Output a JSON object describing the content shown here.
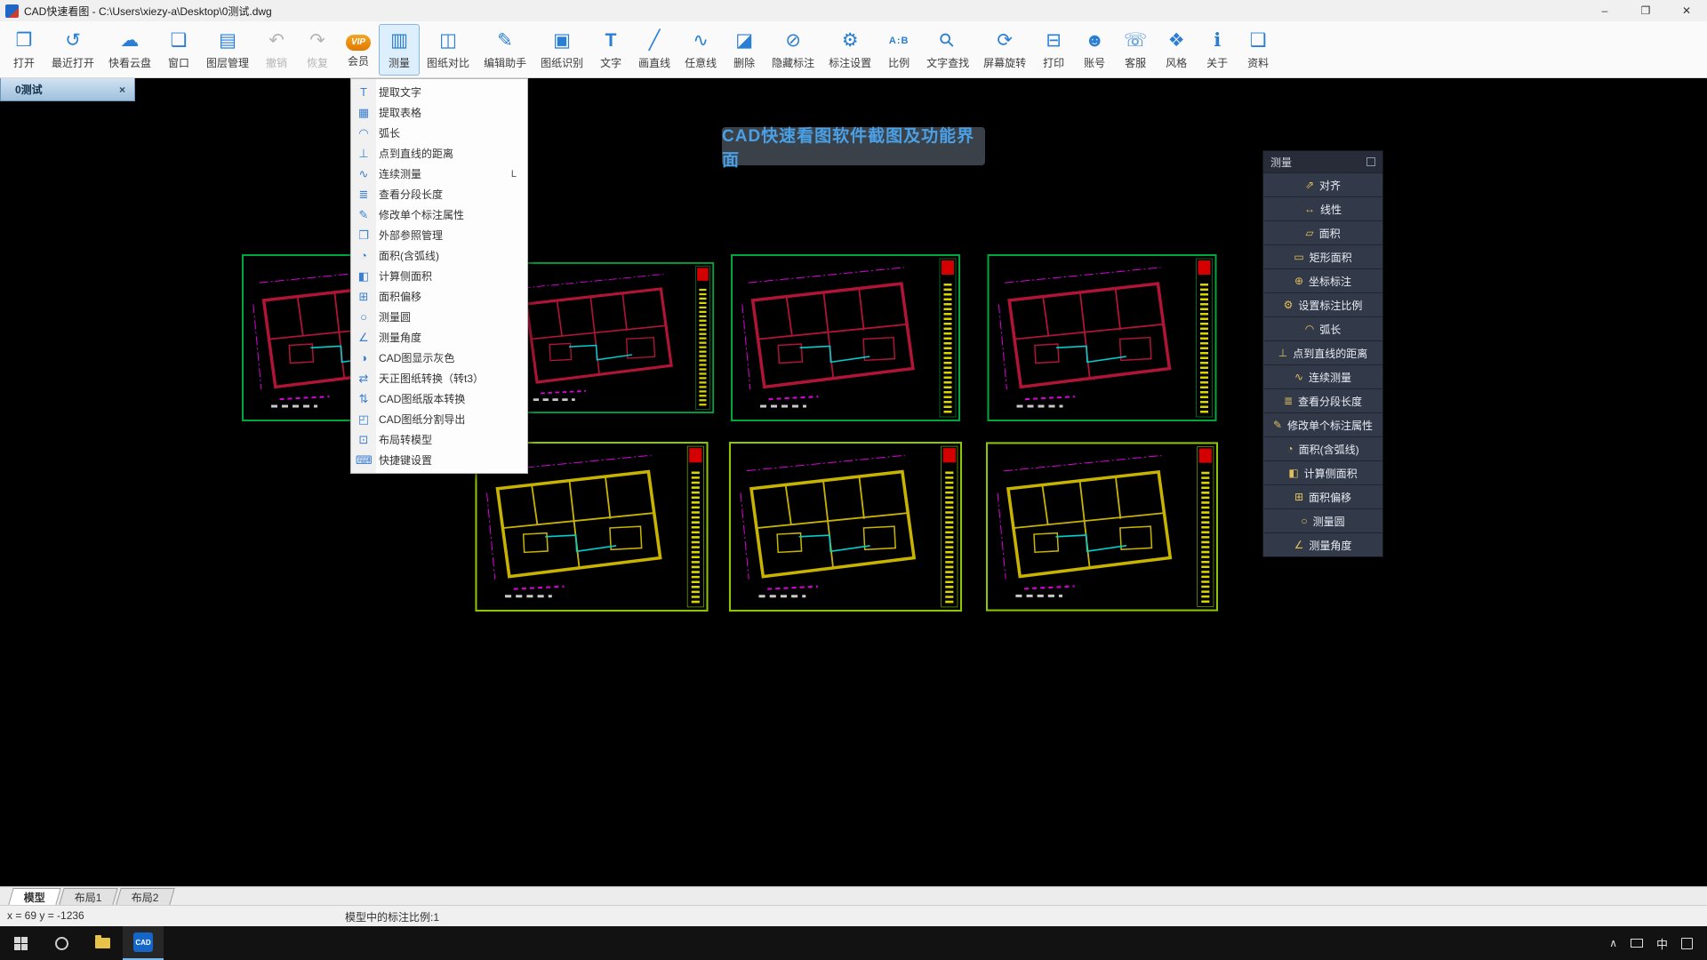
{
  "window": {
    "title": "CAD快速看图 - C:\\Users\\xiezy-a\\Desktop\\0测试.dwg",
    "controls": {
      "minimize": "–",
      "restore": "❐",
      "close": "✕"
    }
  },
  "toolbar": {
    "items": [
      {
        "name": "open-button",
        "icon": "❒",
        "label": "打开"
      },
      {
        "name": "recent-open-button",
        "icon": "↺",
        "label": "最近打开"
      },
      {
        "name": "cloud-drive-button",
        "icon": "☁",
        "label": "快看云盘"
      },
      {
        "name": "window-button",
        "icon": "❏",
        "label": "窗口"
      },
      {
        "name": "layer-manager-button",
        "icon": "▤",
        "label": "图层管理"
      },
      {
        "name": "undo-button",
        "icon": "↶",
        "label": "撤销",
        "disabled": true
      },
      {
        "name": "redo-button",
        "icon": "↷",
        "label": "恢复",
        "disabled": true
      },
      {
        "name": "vip-member-button",
        "icon": "VIP",
        "label": "会员"
      },
      {
        "name": "measure-button",
        "icon": "▥",
        "label": "测量",
        "active": true
      },
      {
        "name": "drawing-compare-button",
        "icon": "◫",
        "label": "图纸对比"
      },
      {
        "name": "edit-assistant-button",
        "icon": "✎",
        "label": "编辑助手"
      },
      {
        "name": "drawing-recognition-button",
        "icon": "▣",
        "label": "图纸识别"
      },
      {
        "name": "text-button",
        "icon": "T",
        "label": "文字"
      },
      {
        "name": "draw-line-button",
        "icon": "╱",
        "label": "画直线"
      },
      {
        "name": "free-line-button",
        "icon": "∿",
        "label": "任意线"
      },
      {
        "name": "delete-button",
        "icon": "◪",
        "label": "删除"
      },
      {
        "name": "hide-annotation-button",
        "icon": "⊘",
        "label": "隐藏标注"
      },
      {
        "name": "annotation-settings-button",
        "icon": "⚙",
        "label": "标注设置"
      },
      {
        "name": "scale-button",
        "icon": "A:B",
        "label": "比例"
      },
      {
        "name": "text-search-button",
        "icon": "⚲",
        "label": "文字查找"
      },
      {
        "name": "screen-rotate-button",
        "icon": "⟳",
        "label": "屏幕旋转"
      },
      {
        "name": "print-button",
        "icon": "⊟",
        "label": "打印"
      },
      {
        "name": "account-button",
        "icon": "☻",
        "label": "账号"
      },
      {
        "name": "customer-service-button",
        "icon": "☏",
        "label": "客服"
      },
      {
        "name": "style-button",
        "icon": "❖",
        "label": "风格"
      },
      {
        "name": "about-button",
        "icon": "ℹ",
        "label": "关于"
      },
      {
        "name": "materials-button",
        "icon": "❑",
        "label": "资料"
      }
    ]
  },
  "doc_tab": {
    "label": "0测试",
    "close_glyph": "×"
  },
  "measure_menu": {
    "items": [
      {
        "name": "menu-extract-text",
        "icon": "T",
        "label": "提取文字"
      },
      {
        "name": "menu-extract-table",
        "icon": "▦",
        "label": "提取表格"
      },
      {
        "name": "menu-arc-length",
        "icon": "◠",
        "label": "弧长"
      },
      {
        "name": "menu-point-to-line-distance",
        "icon": "⊥",
        "label": "点到直线的距离"
      },
      {
        "name": "menu-continuous-measure",
        "icon": "∿",
        "label": "连续测量",
        "shortcut": "L"
      },
      {
        "name": "menu-segment-length",
        "icon": "≣",
        "label": "查看分段长度"
      },
      {
        "name": "menu-modify-annotation",
        "icon": "✎",
        "label": "修改单个标注属性"
      },
      {
        "name": "menu-xref-manager",
        "icon": "❐",
        "label": "外部参照管理"
      },
      {
        "name": "menu-area-with-arc",
        "icon": "◔",
        "label": "面积(含弧线)"
      },
      {
        "name": "menu-side-area",
        "icon": "◧",
        "label": "计算侧面积"
      },
      {
        "name": "menu-area-offset",
        "icon": "⊞",
        "label": "面积偏移"
      },
      {
        "name": "menu-measure-circle",
        "icon": "○",
        "label": "测量圆"
      },
      {
        "name": "menu-measure-angle",
        "icon": "∠",
        "label": "测量角度"
      },
      {
        "name": "menu-cad-gray-display",
        "icon": "◑",
        "label": "CAD图显示灰色"
      },
      {
        "name": "menu-tianzheng-convert",
        "icon": "⇄",
        "label": "天正图纸转换（转t3）"
      },
      {
        "name": "menu-version-convert",
        "icon": "⇅",
        "label": "CAD图纸版本转换"
      },
      {
        "name": "menu-split-export",
        "icon": "◰",
        "label": "CAD图纸分割导出"
      },
      {
        "name": "menu-layout-to-model",
        "icon": "⊡",
        "label": "布局转模型"
      },
      {
        "name": "menu-hotkey-settings",
        "icon": "⌨",
        "label": "快捷键设置"
      }
    ]
  },
  "banner": {
    "text": "CAD快速看图软件截图及功能界面"
  },
  "side_panel": {
    "title": "测量",
    "items": [
      {
        "name": "panel-align",
        "icon": "⇗",
        "label": "对齐"
      },
      {
        "name": "panel-linear",
        "icon": "↔",
        "label": "线性"
      },
      {
        "name": "panel-area",
        "icon": "▱",
        "label": "面积"
      },
      {
        "name": "panel-rect-area",
        "icon": "▭",
        "label": "矩形面积"
      },
      {
        "name": "panel-coordinate-annotation",
        "icon": "⊕",
        "label": "坐标标注"
      },
      {
        "name": "panel-set-annotation-scale",
        "icon": "⚙",
        "label": "设置标注比例"
      },
      {
        "name": "panel-arc-length",
        "icon": "◠",
        "label": "弧长"
      },
      {
        "name": "panel-point-to-line-distance",
        "icon": "⊥",
        "label": "点到直线的距离"
      },
      {
        "name": "panel-continuous-measure",
        "icon": "∿",
        "label": "连续测量"
      },
      {
        "name": "panel-segment-length",
        "icon": "≣",
        "label": "查看分段长度"
      },
      {
        "name": "panel-modify-annotation",
        "icon": "✎",
        "label": "修改单个标注属性"
      },
      {
        "name": "panel-area-with-arc",
        "icon": "◔",
        "label": "面积(含弧线)"
      },
      {
        "name": "panel-side-area",
        "icon": "◧",
        "label": "计算侧面积"
      },
      {
        "name": "panel-area-offset",
        "icon": "⊞",
        "label": "面积偏移"
      },
      {
        "name": "panel-measure-circle",
        "icon": "○",
        "label": "测量圆"
      },
      {
        "name": "panel-measure-angle",
        "icon": "∠",
        "label": "测量角度"
      }
    ]
  },
  "canvas": {
    "drawings_grid": {
      "top_row_count": 4,
      "bottom_row_count": 3
    }
  },
  "bottom_tabs": [
    {
      "name": "sheet-tab-model",
      "label": "模型",
      "active": true
    },
    {
      "name": "sheet-tab-layout1",
      "label": "布局1"
    },
    {
      "name": "sheet-tab-layout2",
      "label": "布局2"
    }
  ],
  "status": {
    "coordinates": "x = 69  y = -1236",
    "scale_text": "模型中的标注比例:1"
  },
  "taskbar": {
    "cad_label": "CAD",
    "tray": {
      "chevron": "∧",
      "ime": "中"
    }
  },
  "theme": {
    "accent": "#2a7fd4",
    "active_bg": "#ddeefc",
    "active_border": "#86b7e8",
    "canvas_bg": "#000000",
    "banner_text": "#4aa0e6",
    "menu_icon": "#3a7fd0",
    "panel_icon": "#e0c05a",
    "frame_green": "#00a83c",
    "frame_green2": "#8fc800",
    "wall_red": "#b01437",
    "wall_yellow": "#c8b400",
    "magenta": "#de00de",
    "cyan": "#00cfcf",
    "yellow": "#d8d800",
    "redblock": "#d40000",
    "spec": "#c8c8c8"
  }
}
